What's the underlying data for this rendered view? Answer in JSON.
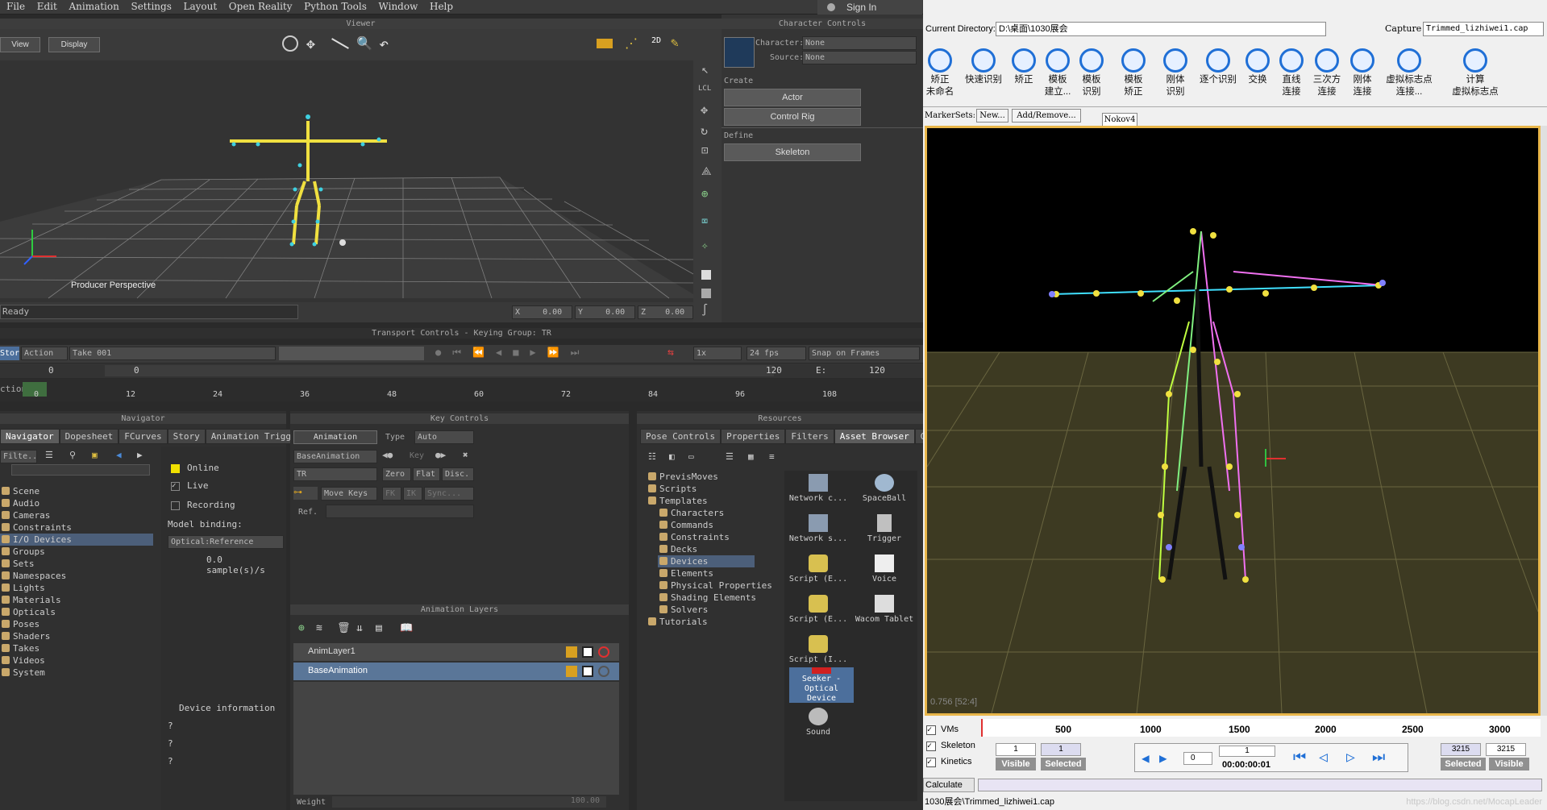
{
  "menu": [
    "File",
    "Edit",
    "Animation",
    "Settings",
    "Layout",
    "Open Reality",
    "Python Tools",
    "Window",
    "Help"
  ],
  "sign_in": "Sign In",
  "viewer": {
    "title": "Viewer",
    "view_btn": "View",
    "display_btn": "Display",
    "camera_label": "Producer Perspective",
    "status": "Ready",
    "x": "0.00",
    "y": "0.00",
    "z": "0.00",
    "axis_x": "X",
    "axis_y": "Y",
    "axis_z": "Z"
  },
  "character_controls": {
    "title": "Character Controls",
    "character_label": "Character:",
    "character_value": "None",
    "source_label": "Source:",
    "source_value": "None",
    "create_label": "Create",
    "actor_btn": "Actor",
    "control_rig_btn": "Control Rig",
    "define_label": "Define",
    "skeleton_btn": "Skeleton"
  },
  "transport": {
    "title": "Transport Controls  -  Keying Group: TR",
    "story": "Story",
    "action": "Action",
    "take": "Take 001",
    "speed": "1x",
    "fps": "24 fps",
    "snap": "Snap on Frames",
    "start": "0",
    "start2": "0",
    "end": "120",
    "end_label": "E:",
    "end2": "120",
    "ticks": [
      "12",
      "24",
      "36",
      "48",
      "60",
      "72",
      "84",
      "96",
      "108"
    ],
    "tick_first": "0",
    "left_label": "ction"
  },
  "navigator": {
    "title": "Navigator",
    "tabs": [
      "Navigator",
      "Dopesheet",
      "FCurves",
      "Story",
      "Animation Trigge"
    ],
    "filter": "Filte...",
    "items": [
      "Scene",
      "Audio",
      "Cameras",
      "Constraints",
      "I/O Devices",
      "Groups",
      "Sets",
      "Namespaces",
      "Lights",
      "Materials",
      "Opticals",
      "Poses",
      "Shaders",
      "Takes",
      "Videos",
      "System"
    ],
    "selected_index": 4,
    "online": "Online",
    "live": "Live",
    "recording": "Recording",
    "model_binding": "Model binding:",
    "binding_value": "Optical:Reference",
    "sample": "0.0 sample(s)/s",
    "device_info": "Device information",
    "q": [
      "?",
      "?",
      "?"
    ]
  },
  "key_controls": {
    "title": "Key Controls",
    "animation": "Animation",
    "type_label": "Type",
    "type_value": "Auto",
    "layer": "BaseAnimation",
    "key": "Key",
    "tr": "TR",
    "zero": "Zero",
    "flat": "Flat",
    "disc": "Disc.",
    "move_keys": "Move Keys",
    "fk": "FK",
    "ik": "IK",
    "sync": "Sync...",
    "ref": "Ref."
  },
  "anim_layers": {
    "title": "Animation Layers",
    "layers": [
      "AnimLayer1",
      "BaseAnimation"
    ],
    "weight": "Weight",
    "weight_value": "100.00"
  },
  "resources": {
    "title": "Resources",
    "tabs": [
      "Pose Controls",
      "Properties",
      "Filters",
      "Asset Browser",
      "G"
    ],
    "tree": [
      "PrevisMoves",
      "Scripts",
      "Templates",
      "Characters",
      "Commands",
      "Constraints",
      "Decks",
      "Devices",
      "Elements",
      "Physical Properties",
      "Shading Elements",
      "Solvers",
      "Tutorials"
    ],
    "selected_index": 7,
    "assets": [
      [
        "Network c...",
        "SpaceBall"
      ],
      [
        "Network s...",
        "Trigger"
      ],
      [
        "Script (E...",
        "Voice"
      ],
      [
        "Script (E...",
        "Wacom Tablet"
      ],
      [
        "Script (I...",
        ""
      ],
      [
        "Seeker - Optical Device",
        ""
      ],
      [
        "Sound",
        ""
      ]
    ]
  },
  "right": {
    "current_dir_label": "Current Directory:",
    "current_dir": "D:\\桌面\\1030展会",
    "capture_label": "Capture",
    "capture_value": "Trimmed_lizhiwei1.cap",
    "tools": [
      [
        "矫正",
        "未命名"
      ],
      [
        "快速识别",
        ""
      ],
      [
        "矫正",
        ""
      ],
      [
        "模板",
        "建立..."
      ],
      [
        "模板",
        "识别"
      ],
      [
        "模板",
        "矫正"
      ],
      [
        "刚体",
        "识别"
      ],
      [
        "逐个识别",
        ""
      ],
      [
        "交换",
        ""
      ],
      [
        "直线",
        "连接"
      ],
      [
        "三次方",
        "连接"
      ],
      [
        "刚体",
        "连接"
      ],
      [
        "虚拟标志点",
        "连接..."
      ],
      [
        "计算",
        "虚拟标志点"
      ]
    ],
    "markersets": "MarkerSets:",
    "new": "New...",
    "add_remove": "Add/Remove...",
    "tab": "Nokov4",
    "fps_text": "0.756 [52:4]",
    "vms": "VMs",
    "skeleton": "Skeleton",
    "kinetics": "Kinetics",
    "ticks": [
      "500",
      "1000",
      "1500",
      "2000",
      "2500",
      "3000"
    ],
    "f1": "1",
    "f2": "1",
    "visible": "Visible",
    "selected": "Selected",
    "spin": "0",
    "frame": "1",
    "timecode": "00:00:00:01",
    "end1": "3215",
    "end2": "3215",
    "calculate": "Calculate",
    "file": "1030展会\\Trimmed_lizhiwei1.cap",
    "watermark": "https://blog.csdn.net/MocapLeader"
  }
}
